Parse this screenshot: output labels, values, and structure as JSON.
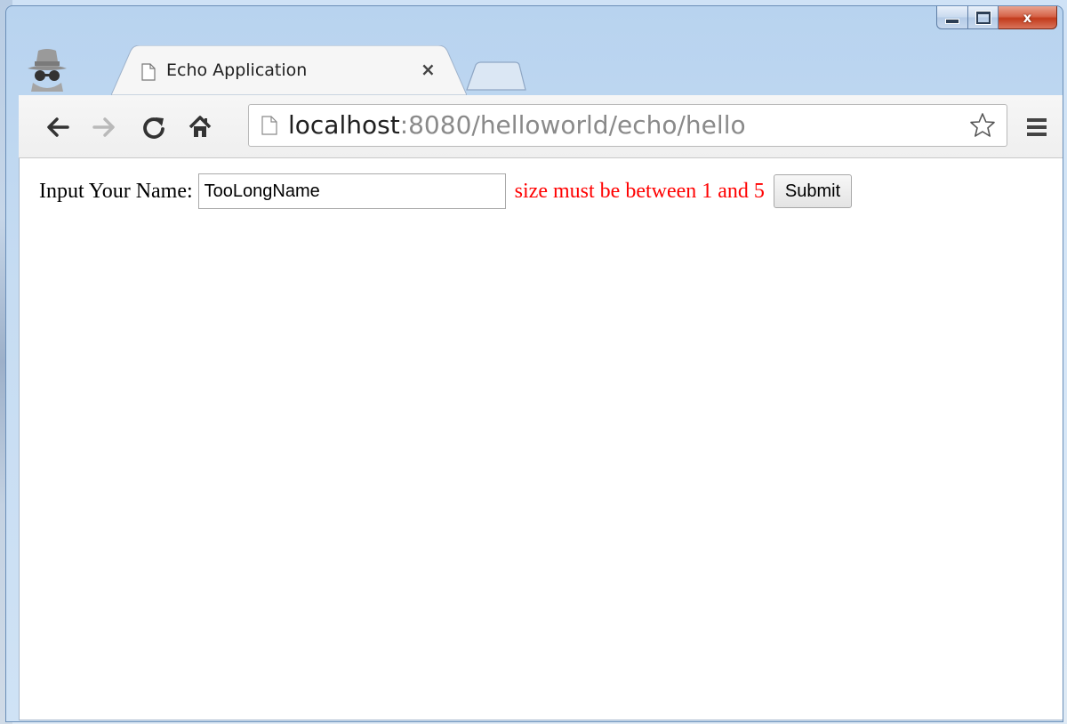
{
  "browser": {
    "tab": {
      "title": "Echo Application",
      "close_glyph": "×",
      "icon": "file-icon"
    },
    "window_controls": {
      "minimize": "minimize-icon",
      "maximize": "maximize-icon",
      "close_glyph": "x"
    },
    "toolbar": {
      "back": "←",
      "forward": "→",
      "reload": "reload-icon",
      "home": "home-icon",
      "menu": "menu-icon"
    },
    "omnibox": {
      "host": "localhost",
      "path": ":8080/helloworld/echo/hello",
      "icon": "file-icon",
      "bookmark": "star-icon"
    },
    "mode": "incognito"
  },
  "page": {
    "label": "Input Your Name:",
    "name_value": "TooLongName",
    "error_message": "size must be between 1 and 5",
    "submit_label": "Submit",
    "error_color": "#ff0000"
  }
}
